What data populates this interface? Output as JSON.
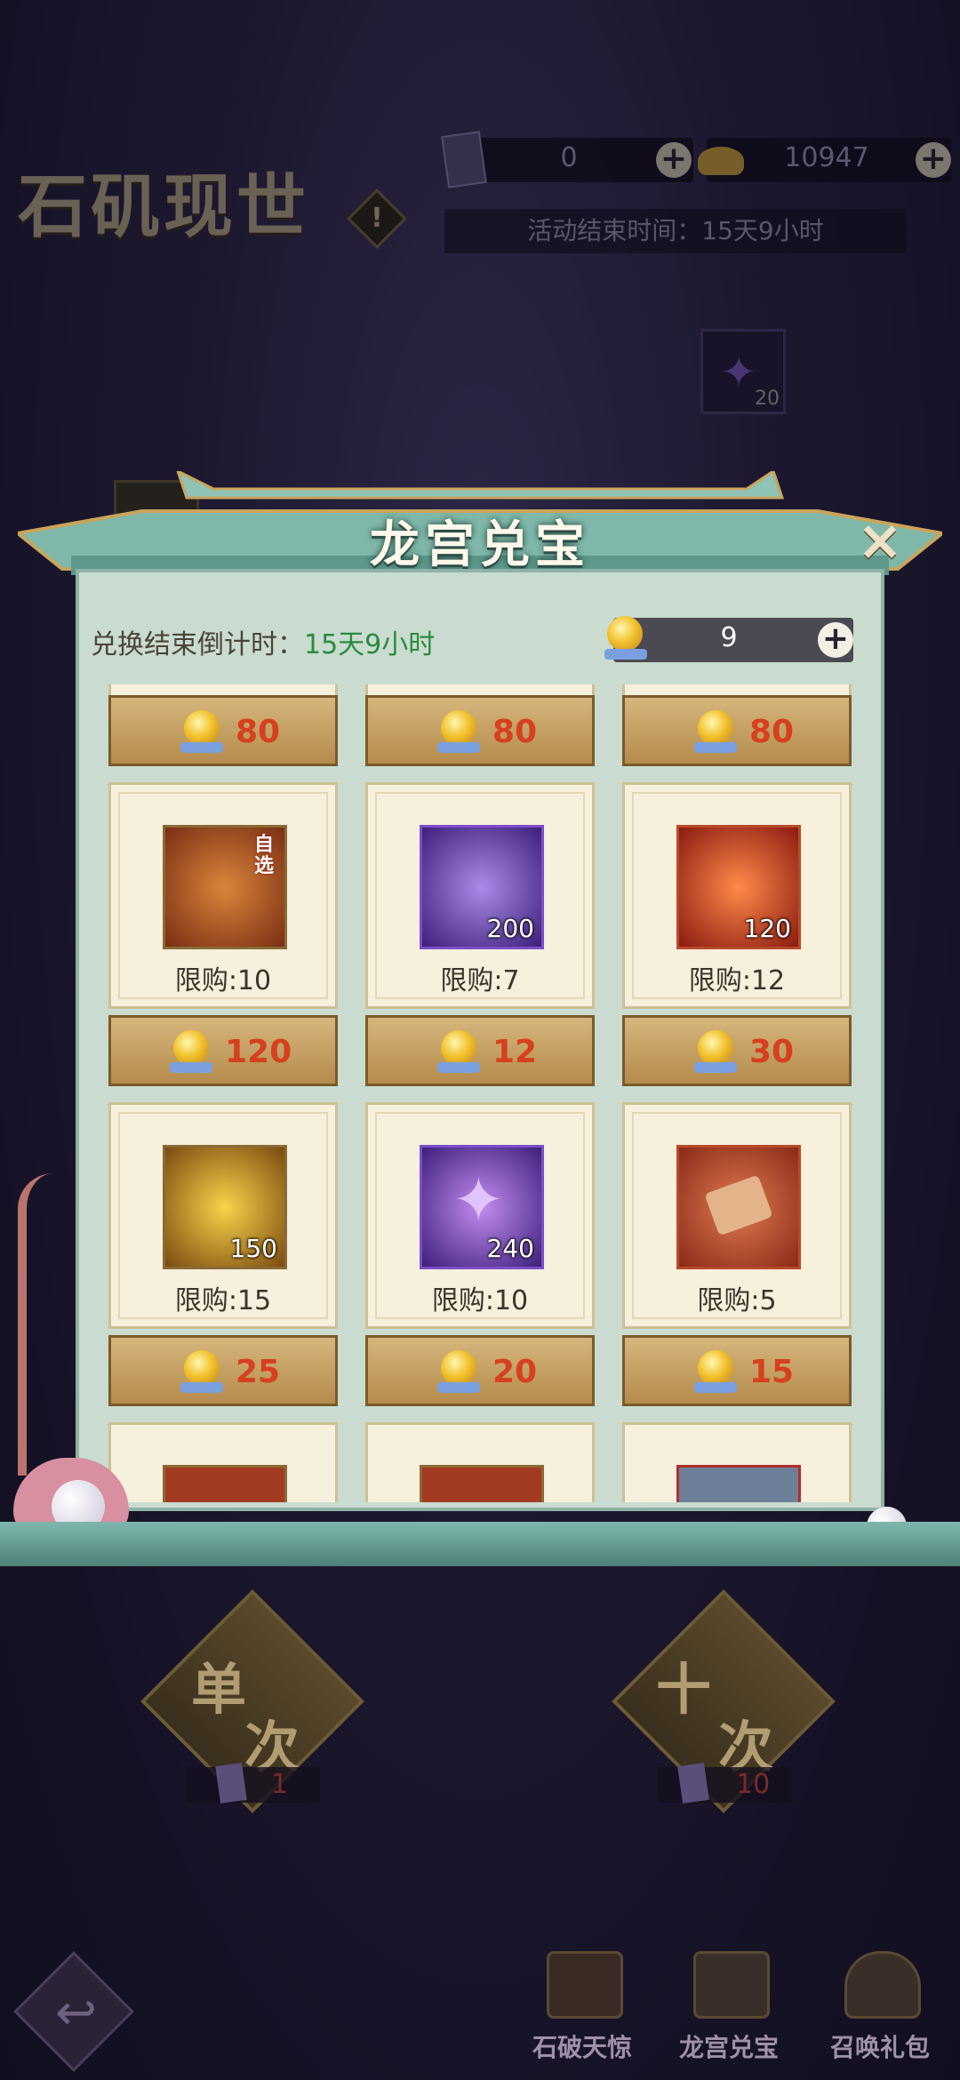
{
  "event": {
    "title": "石矶现世",
    "info_icon": "!",
    "ticket_count": "0",
    "gold_ingot_count": "10947",
    "end_time": "活动结束时间：15天9小时",
    "bg_item_count": "20"
  },
  "popup": {
    "title": "龙宫兑宝",
    "close_icon": "×",
    "countdown_label": "兑换结束倒计时：",
    "countdown_value": "15天9小时",
    "currency_value": "9",
    "plus_icon": "+"
  },
  "shop": {
    "top_prices": [
      "80",
      "80",
      "80"
    ],
    "row1": [
      {
        "name": "gift-box",
        "count": "",
        "tag": "自选",
        "limit": "限购:10",
        "price": "120",
        "color": "#b24a1f"
      },
      {
        "name": "purple-stone",
        "count": "200",
        "tag": "",
        "limit": "限购:7",
        "price": "12",
        "color": "#6a3bc2"
      },
      {
        "name": "fire-orb",
        "count": "120",
        "tag": "",
        "limit": "限购:12",
        "price": "30",
        "color": "#c93a2a"
      }
    ],
    "row2": [
      {
        "name": "gold-jade",
        "count": "150",
        "tag": "",
        "limit": "限购:15",
        "price": "25",
        "color": "#9a6a24"
      },
      {
        "name": "purple-star",
        "count": "240",
        "tag": "",
        "limit": "限购:10",
        "price": "20",
        "color": "#6a3bc2"
      },
      {
        "name": "rock-shards",
        "count": "",
        "tag": "",
        "limit": "限购:5",
        "price": "15",
        "color": "#c74a2e"
      }
    ]
  },
  "draw": {
    "single_label_1": "单",
    "single_label_2": "次",
    "single_cost": "1",
    "ten_label_1": "十",
    "ten_label_2": "次",
    "ten_cost": "10"
  },
  "nav": {
    "tab1": "石破天惊",
    "tab2": "龙宫兑宝",
    "tab3": "召唤礼包"
  }
}
